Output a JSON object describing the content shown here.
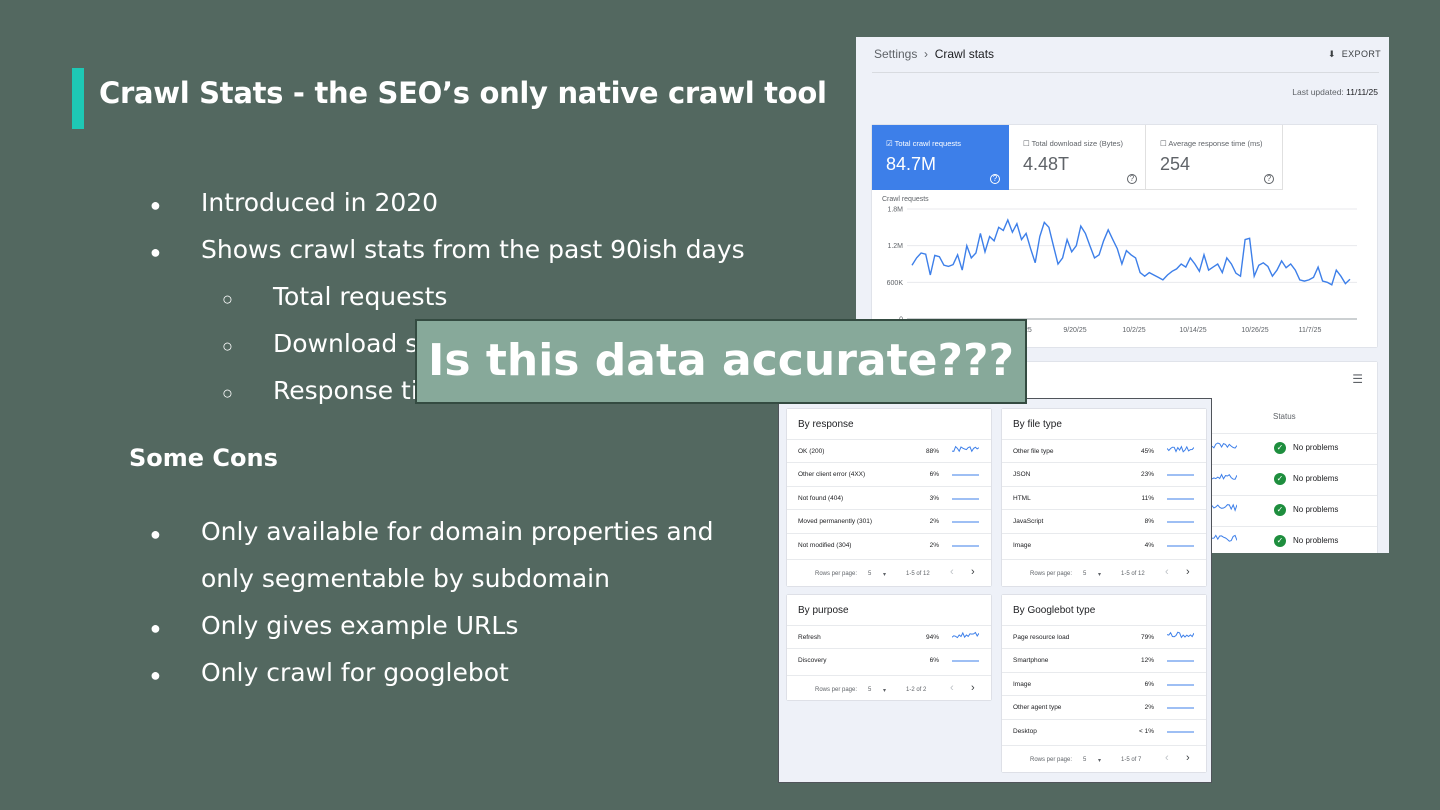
{
  "slide": {
    "title": "Crawl Stats - the SEO’s only native crawl tool",
    "bullets": [
      "Introduced in 2020",
      "Shows crawl stats from the past 90ish days"
    ],
    "sub_bullets": [
      "Total requests",
      "Download s",
      "Response ti"
    ],
    "bullet_glyph": "●",
    "sub_glyph": "○",
    "cons_heading": "Some Cons",
    "cons": [
      "Only available for domain properties and",
      "only segmentable by subdomain",
      "Only gives example URLs",
      "Only crawl for googlebot"
    ],
    "overlay_text": "Is this data accurate???",
    "colors": {
      "background": "#536860",
      "accent_bar": "#1ec8b5",
      "overlay": "#87a99a"
    }
  },
  "crawl_stats_panel": {
    "breadcrumb_parent": "Settings",
    "breadcrumb_sep": "›",
    "breadcrumb_current": "Crawl stats",
    "export_icon": "download-icon",
    "export_label": "EXPORT",
    "last_updated_label": "Last updated:",
    "last_updated_value": "11/11/25",
    "metrics": [
      {
        "label": "Total crawl requests",
        "value": "84.7M",
        "checked": true
      },
      {
        "label": "Total download size (Bytes)",
        "value": "4.48T",
        "checked": false
      },
      {
        "label": "Average response time (ms)",
        "value": "254",
        "checked": false
      }
    ],
    "status_header": "Status",
    "status_rows": [
      "No problems",
      "No problems",
      "No problems",
      "No problems"
    ]
  },
  "chart_data": {
    "type": "line",
    "ylabel": "Crawl requests",
    "y_ticks": [
      "1.8M",
      "1.2M",
      "600K",
      "0"
    ],
    "x_ticks": [
      "9/8/25",
      "9/20/25",
      "10/2/25",
      "10/14/25",
      "10/26/25",
      "11/7/25"
    ],
    "ylim": [
      0,
      1800000
    ],
    "series": [
      {
        "values": [
          880000,
          1000000,
          1080000,
          1060000,
          720000,
          1040000,
          1020000,
          880000,
          860000,
          890000,
          1050000,
          800000,
          1200000,
          1000000,
          1080000,
          1400000,
          1100000,
          1350000,
          1280000,
          1500000,
          1450000,
          1620000,
          1420000,
          1560000,
          1300000,
          1400000,
          1150000,
          920000,
          1350000,
          1580000,
          1500000,
          1200000,
          900000,
          1000000,
          1300000,
          1100000,
          1200000,
          1520000,
          1400000,
          1200000,
          1000000,
          1050000,
          1280000,
          1460000,
          1300000,
          1150000,
          900000,
          1120000,
          1050000,
          1000000,
          760000,
          700000,
          760000,
          720000,
          680000,
          640000,
          720000,
          780000,
          820000,
          900000,
          850000,
          1000000,
          900000,
          780000,
          1050000,
          800000,
          850000,
          900000,
          760000,
          1000000,
          900000,
          750000,
          700000,
          1300000,
          1320000,
          700000,
          880000,
          920000,
          860000,
          700000,
          800000,
          950000,
          840000,
          900000,
          800000,
          640000,
          620000,
          640000,
          680000,
          850000,
          620000,
          600000,
          560000,
          800000,
          700000,
          580000,
          650000
        ]
      }
    ]
  },
  "segment_panel": {
    "cards": [
      {
        "title": "By response",
        "rows": [
          {
            "label": "OK (200)",
            "pct": "88%"
          },
          {
            "label": "Other client error (4XX)",
            "pct": "6%"
          },
          {
            "label": "Not found (404)",
            "pct": "3%"
          },
          {
            "label": "Moved permanently (301)",
            "pct": "2%"
          },
          {
            "label": "Not modified (304)",
            "pct": "2%"
          }
        ],
        "rows_per_page_label": "Rows per page:",
        "rows_per_page": "5",
        "range": "1-5 of 12"
      },
      {
        "title": "By file type",
        "rows": [
          {
            "label": "Other file type",
            "pct": "45%"
          },
          {
            "label": "JSON",
            "pct": "23%"
          },
          {
            "label": "HTML",
            "pct": "11%"
          },
          {
            "label": "JavaScript",
            "pct": "8%"
          },
          {
            "label": "Image",
            "pct": "4%"
          }
        ],
        "rows_per_page_label": "Rows per page:",
        "rows_per_page": "5",
        "range": "1-5 of 12"
      },
      {
        "title": "By purpose",
        "rows": [
          {
            "label": "Refresh",
            "pct": "94%"
          },
          {
            "label": "Discovery",
            "pct": "6%"
          }
        ],
        "rows_per_page_label": "Rows per page:",
        "rows_per_page": "5",
        "range": "1-2 of 2"
      },
      {
        "title": "By Googlebot type",
        "rows": [
          {
            "label": "Page resource load",
            "pct": "79%"
          },
          {
            "label": "Smartphone",
            "pct": "12%"
          },
          {
            "label": "Image",
            "pct": "6%"
          },
          {
            "label": "Other agent type",
            "pct": "2%"
          },
          {
            "label": "Desktop",
            "pct": "< 1%"
          }
        ],
        "rows_per_page_label": "Rows per page:",
        "rows_per_page": "5",
        "range": "1-5 of 7"
      }
    ],
    "prev_icon": "chevron-left-icon",
    "next_icon": "chevron-right-icon",
    "dropdown_icon": "caret-down-icon"
  }
}
